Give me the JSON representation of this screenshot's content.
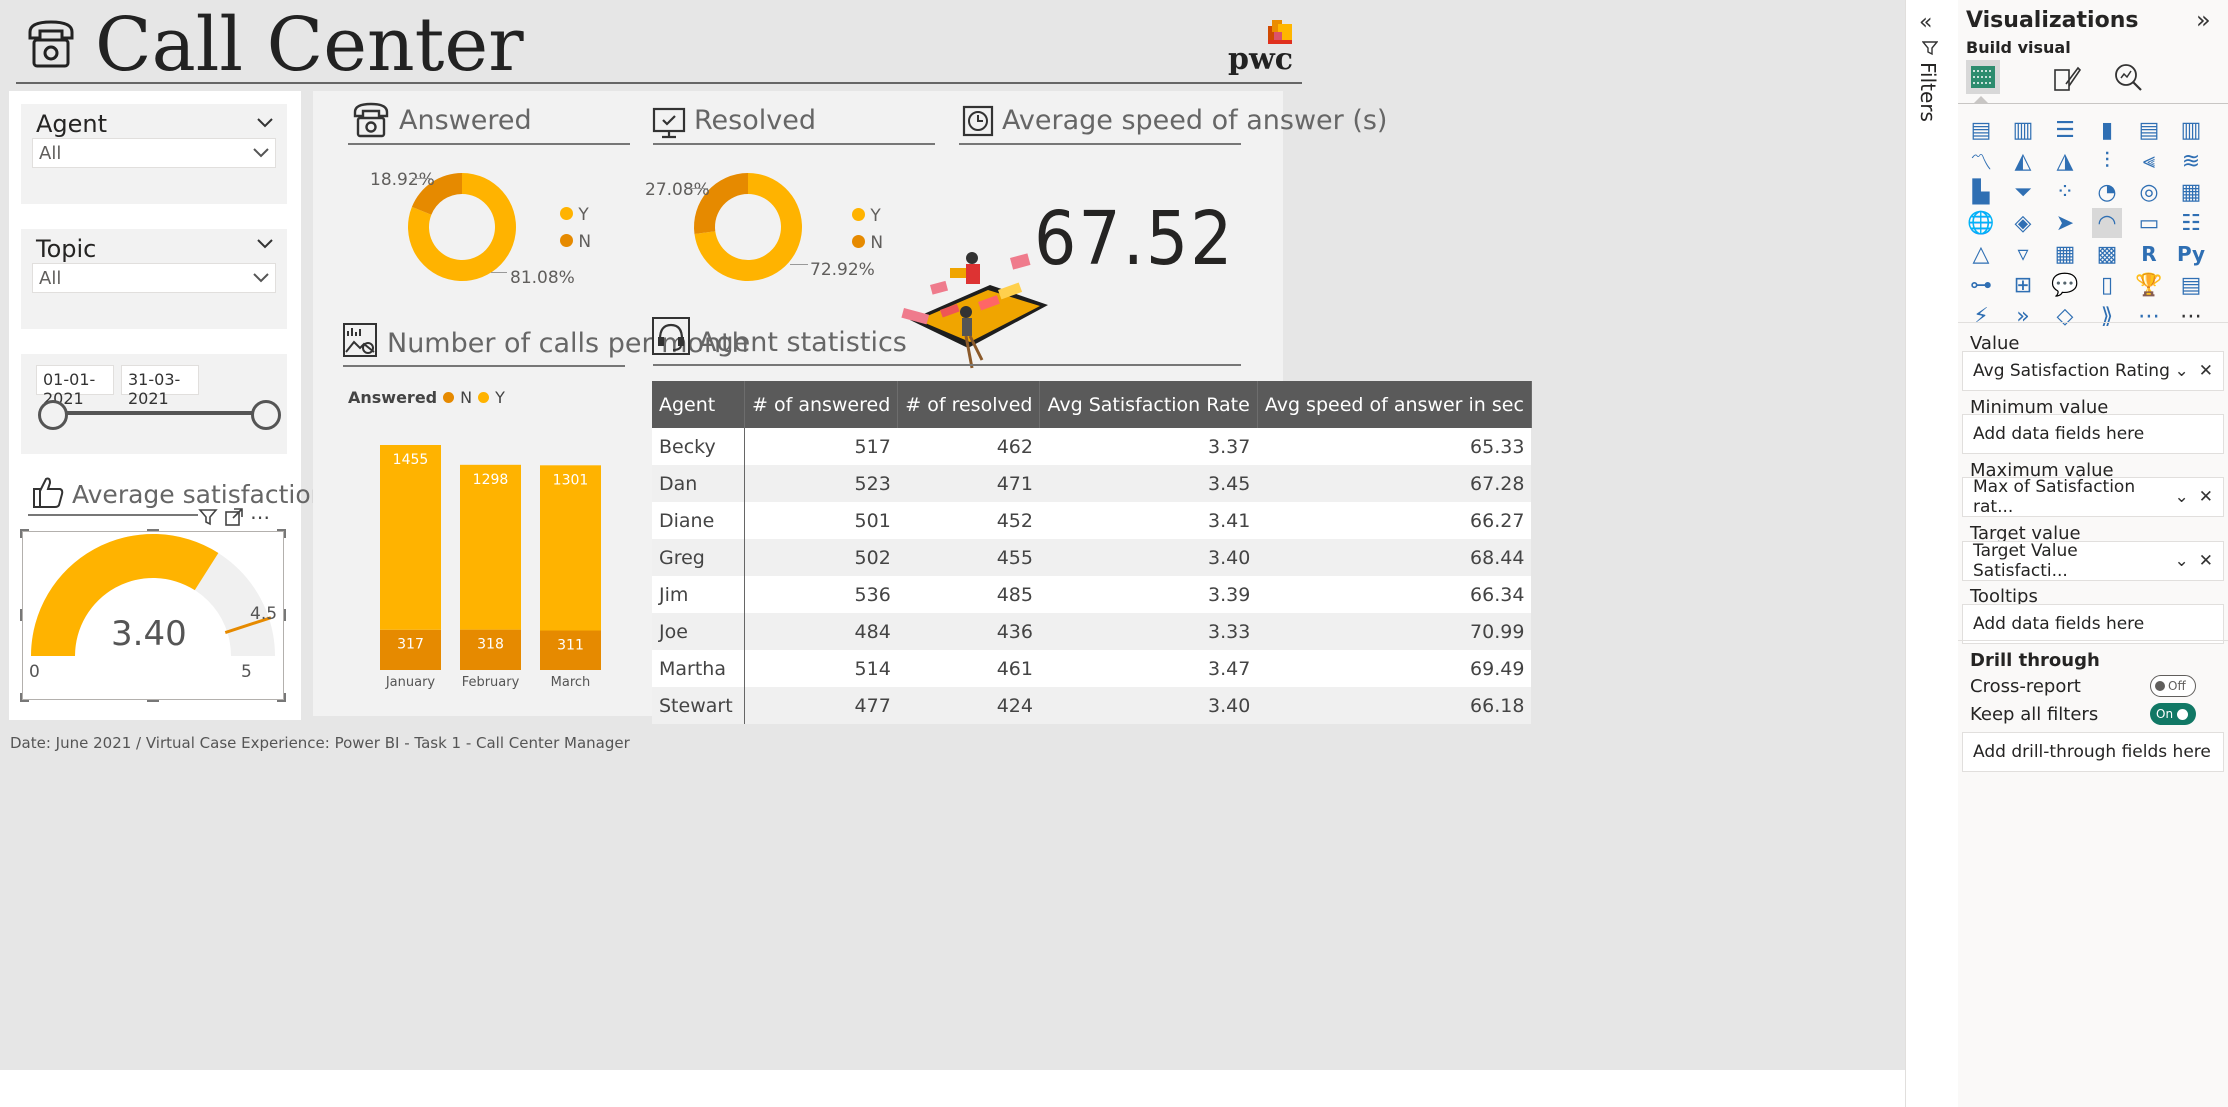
{
  "header": {
    "title": "Call Center",
    "logo_text": "pwc"
  },
  "slicers": {
    "agent": {
      "label": "Agent",
      "value": "All"
    },
    "topic": {
      "label": "Topic",
      "value": "All"
    },
    "date": {
      "start": "01-01-2021",
      "end": "31-03-2021"
    }
  },
  "avg_satisfaction": {
    "title": "Average satisfaction",
    "value": "3.40",
    "min": "0",
    "max": "5",
    "target": "4.5",
    "gauge_fraction": 0.68,
    "target_fraction": 0.9
  },
  "answered": {
    "title": "Answered",
    "pct_n": "18.92%",
    "pct_y": "81.08%",
    "legend_y": "Y",
    "legend_n": "N",
    "fraction_n": 0.1892
  },
  "resolved": {
    "title": "Resolved",
    "pct_n": "27.08%",
    "pct_y": "72.92%",
    "legend_y": "Y",
    "legend_n": "N",
    "fraction_n": 0.2708
  },
  "speed": {
    "title": "Average speed of answer (s)",
    "value": "67.52"
  },
  "calls_chart": {
    "title": "Number of calls per month",
    "legend_title": "Answered",
    "legend_n": "N",
    "legend_y": "Y"
  },
  "chart_data": {
    "type": "bar",
    "stacked": true,
    "categories": [
      "January",
      "February",
      "March"
    ],
    "series": [
      {
        "name": "N",
        "values": [
          317,
          318,
          311
        ],
        "color": "#e68a00"
      },
      {
        "name": "Y",
        "values": [
          1455,
          1298,
          1301
        ],
        "color": "#ffb300"
      }
    ]
  },
  "agent_stats": {
    "title": "Agent statistics",
    "columns": [
      "Agent",
      "# of answered",
      "# of resolved",
      "Avg Satisfaction Rate",
      "Avg speed of answer in sec"
    ],
    "rows": [
      [
        "Becky",
        "517",
        "462",
        "3.37",
        "65.33"
      ],
      [
        "Dan",
        "523",
        "471",
        "3.45",
        "67.28"
      ],
      [
        "Diane",
        "501",
        "452",
        "3.41",
        "66.27"
      ],
      [
        "Greg",
        "502",
        "455",
        "3.40",
        "68.44"
      ],
      [
        "Jim",
        "536",
        "485",
        "3.39",
        "66.34"
      ],
      [
        "Joe",
        "484",
        "436",
        "3.33",
        "70.99"
      ],
      [
        "Martha",
        "514",
        "461",
        "3.47",
        "69.49"
      ],
      [
        "Stewart",
        "477",
        "424",
        "3.40",
        "66.18"
      ]
    ]
  },
  "footer": {
    "text": "Date: June 2021 / Virtual Case Experience: Power BI - Task 1 - Call Center Manager"
  },
  "filters_pane": {
    "label": "Filters"
  },
  "viz_pane": {
    "title": "Visualizations",
    "build_visual": "Build visual",
    "wells": {
      "value_label": "Value",
      "value_field": "Avg Satisfaction Rating",
      "min_label": "Minimum value",
      "min_placeholder": "Add data fields here",
      "max_label": "Maximum value",
      "max_field": "Max of Satisfaction rat...",
      "target_label": "Target value",
      "target_field": "Target Value Satisfacti...",
      "tooltips_label": "Tooltips",
      "tooltips_placeholder": "Add data fields here"
    },
    "drill": {
      "title": "Drill through",
      "cross_report": "Cross-report",
      "cross_state": "Off",
      "keep_filters": "Keep all filters",
      "keep_state": "On",
      "add_fields": "Add drill-through fields here"
    },
    "icon_names": [
      "stacked-bar",
      "stacked-column",
      "clustered-bar",
      "clustered-column",
      "100-bar",
      "100-column",
      "line",
      "area",
      "stacked-area",
      "line-column",
      "line-clustered",
      "ribbon",
      "waterfall",
      "funnel",
      "scatter",
      "pie",
      "donut",
      "treemap",
      "map",
      "filled-map",
      "azure-map",
      "gauge",
      "card",
      "multi-row-card",
      "kpi",
      "slicer",
      "table",
      "matrix",
      "r-visual",
      "python-visual",
      "key-influencers",
      "decomposition-tree",
      "qa",
      "paginated",
      "trophy",
      "smart-narrative",
      "power-apps",
      "power-automate",
      "custom-a",
      "custom-b",
      "custom-c",
      "more"
    ]
  }
}
